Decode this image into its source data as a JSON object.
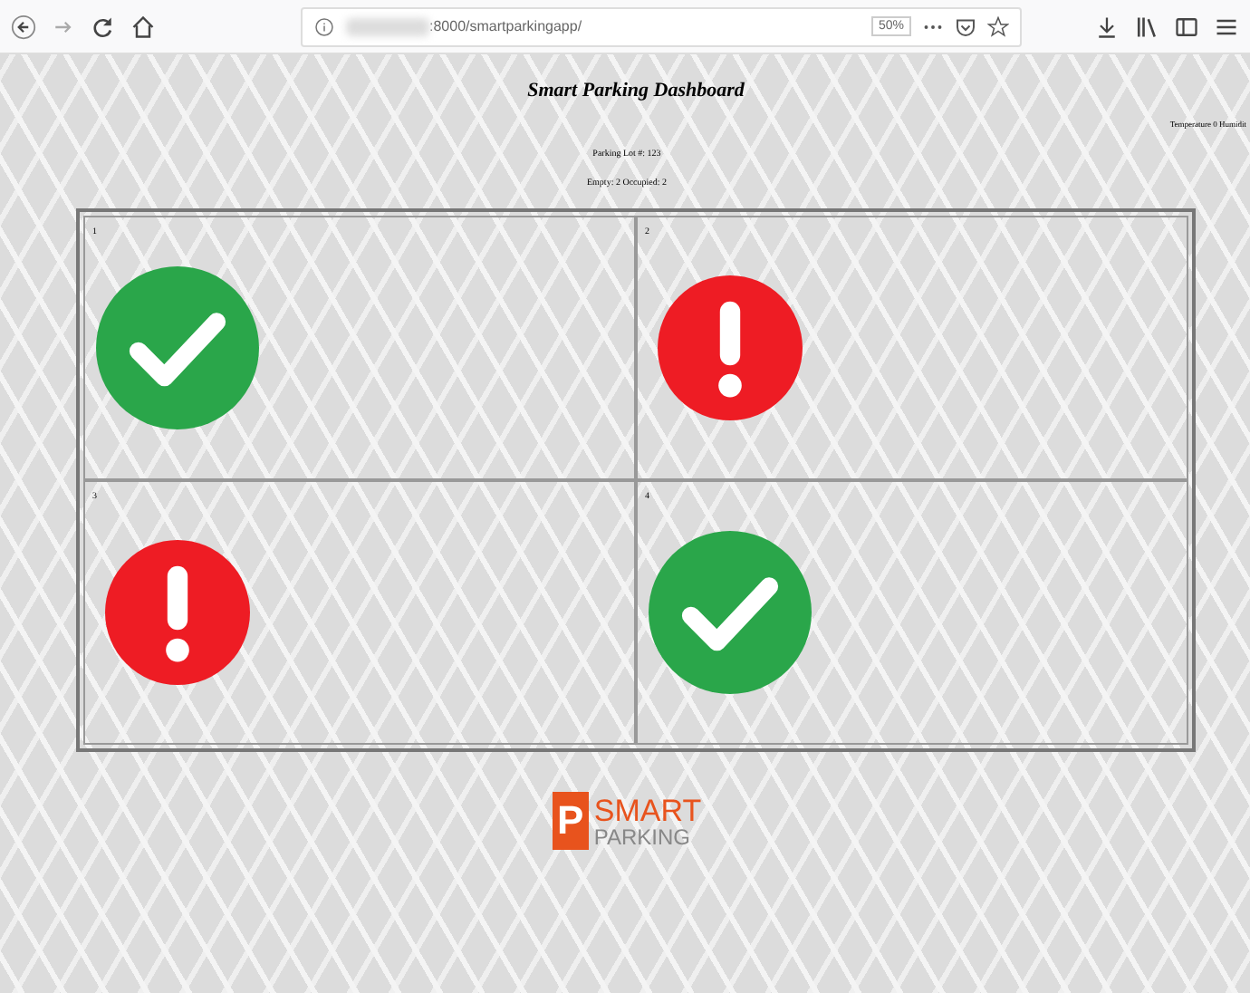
{
  "browser": {
    "url": ":8000/smartparkingapp/",
    "zoom": "50%"
  },
  "title": "Smart Parking Dashboard",
  "sensor": "Temperature 0 Humidit",
  "lot": "Parking Lot #: 123",
  "summary": "Empty: 2 Occupied: 2",
  "slots": [
    {
      "number": "1",
      "kind": "empty"
    },
    {
      "number": "2",
      "kind": "occupied"
    },
    {
      "number": "3",
      "kind": "occupied"
    },
    {
      "number": "4",
      "kind": "empty"
    }
  ],
  "logo": {
    "top": "SMART",
    "bottom": "PARKING",
    "mark": "P"
  }
}
